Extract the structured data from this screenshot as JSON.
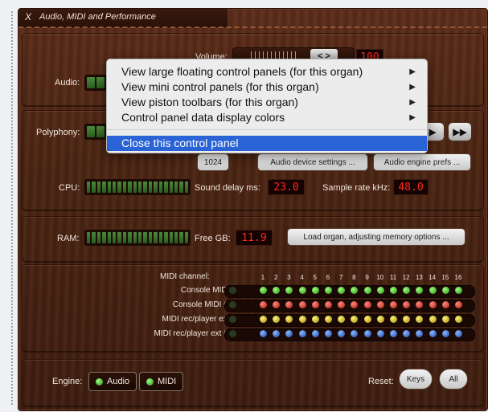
{
  "window": {
    "title": "Audio, MIDI and Performance",
    "close_glyph": "X"
  },
  "audio": {
    "label": "Audio:",
    "volume_label": "Volume:",
    "volume_knob": "< >",
    "volume_value": "100",
    "volume_level": 0.85
  },
  "polyphony": {
    "label": "Polyphony:",
    "buffer_value": "1024",
    "audio_device_button": "Audio device settings ...",
    "audio_engine_button": "Audio engine prefs ...",
    "next_glyph": "▶",
    "fast_forward_glyph": "▶▶"
  },
  "cpu": {
    "label": "CPU:",
    "sound_delay_label": "Sound delay ms:",
    "sound_delay_value": "23.0",
    "sample_rate_label": "Sample rate kHz:",
    "sample_rate_value": "48.0"
  },
  "ram": {
    "label": "RAM:",
    "free_gb_label": "Free GB:",
    "free_gb_value": "11.9",
    "load_organ_button": "Load organ, adjusting memory options ..."
  },
  "midi": {
    "channel_label": "MIDI channel:",
    "channels": [
      "1",
      "2",
      "3",
      "4",
      "5",
      "6",
      "7",
      "8",
      "9",
      "10",
      "11",
      "12",
      "13",
      "14",
      "15",
      "16"
    ],
    "rows": [
      {
        "label": "Console MIDI IN:",
        "color": "green"
      },
      {
        "label": "Console MIDI OUT:",
        "color": "red"
      },
      {
        "label": "MIDI rec/player ext IN:",
        "color": "yellow"
      },
      {
        "label": "MIDI rec/player ext OUT:",
        "color": "blue"
      }
    ]
  },
  "engine": {
    "label": "Engine:",
    "audio_button": "Audio",
    "midi_button": "MIDI",
    "reset_label": "Reset:",
    "keys_button": "Keys",
    "all_button": "All"
  },
  "context_menu": {
    "items": [
      {
        "label": "View large floating control panels (for this organ)",
        "submenu": true
      },
      {
        "label": "View mini control panels (for this organ)",
        "submenu": true
      },
      {
        "label": "View piston toolbars (for this organ)",
        "submenu": true
      },
      {
        "label": "Control panel data display colors",
        "submenu": true
      },
      {
        "label": "Close this control panel",
        "submenu": false,
        "selected": true
      }
    ],
    "submenu_glyph": "▶"
  },
  "colors": {
    "accent_selected": "#2a63d6",
    "readout_text": "#ff2a1a",
    "wood_dark": "#3d1d10"
  }
}
